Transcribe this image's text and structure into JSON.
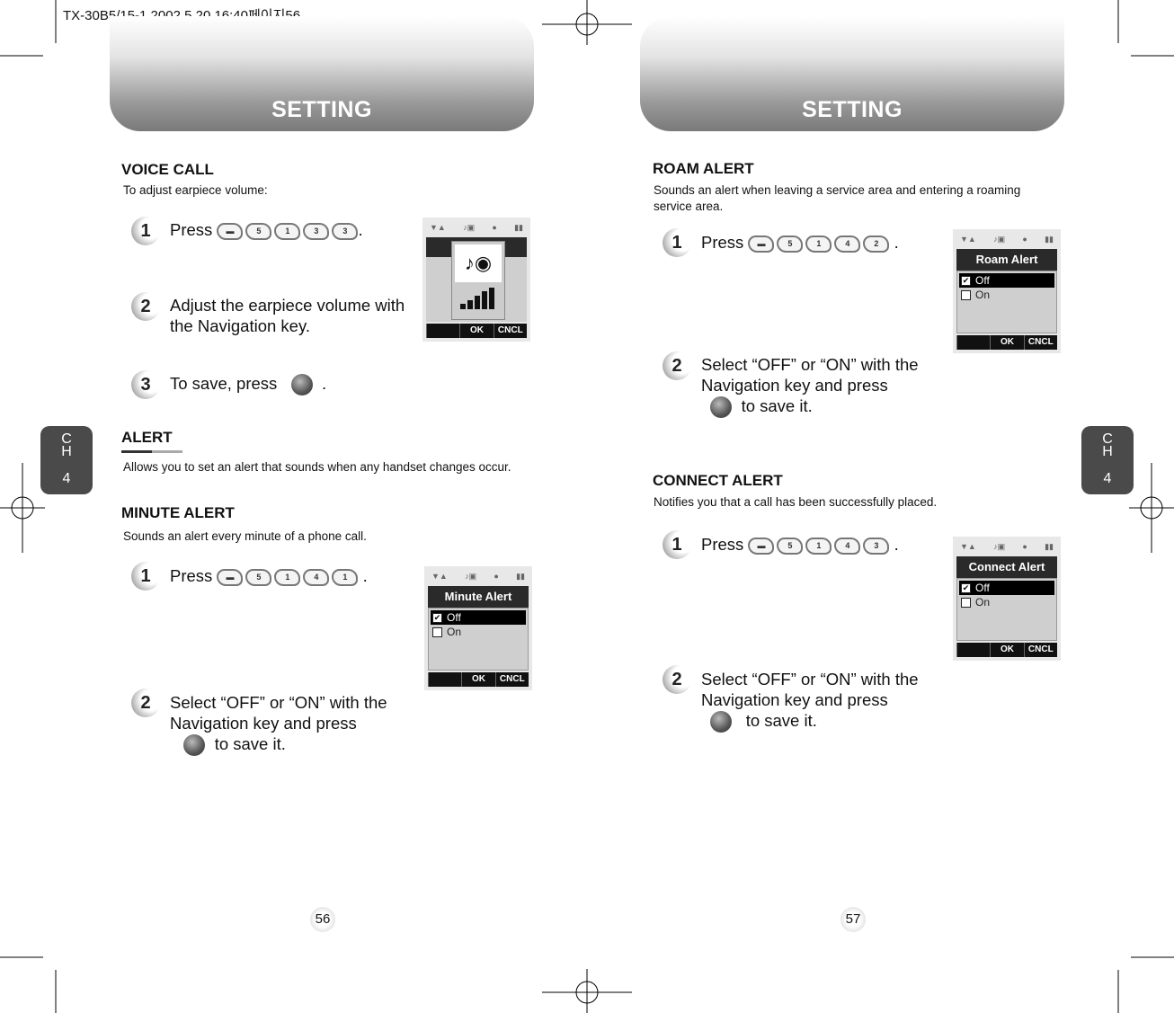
{
  "print_header": "TX-30B5/15-1  2002.5.20 16:40페이지56",
  "left": {
    "header": "SETTING",
    "chapter": {
      "c": "C",
      "h": "H",
      "n": "4"
    },
    "page": "56",
    "voice_call": {
      "title": "VOICE CALL",
      "desc": "To adjust earpiece volume:",
      "step1": {
        "n": "1",
        "text": "Press",
        "keys": [
          "menu",
          "5",
          "1",
          "3",
          "3"
        ],
        "end": "."
      },
      "step2": {
        "n": "2",
        "text": "Adjust the earpiece volume with the Navigation key."
      },
      "step3": {
        "n": "3",
        "text": "To save, press",
        "end": "."
      },
      "screen": {
        "softkeys": [
          "",
          "OK",
          "CNCL"
        ]
      }
    },
    "alert": {
      "title": "ALERT",
      "desc": "Allows you to set an alert that sounds when any handset changes occur."
    },
    "minute_alert": {
      "title": "MINUTE ALERT",
      "desc": "Sounds an alert every minute of a phone call.",
      "step1": {
        "n": "1",
        "text": "Press",
        "keys": [
          "menu",
          "5",
          "1",
          "4",
          "1"
        ],
        "end": "."
      },
      "step2": {
        "n": "2",
        "text": "Select “OFF” or “ON” with the Navigation key and press",
        "end": "to save it."
      },
      "screen": {
        "title": "Minute Alert",
        "options": [
          "Off",
          "On"
        ],
        "softkeys": [
          "",
          "OK",
          "CNCL"
        ]
      }
    }
  },
  "right": {
    "header": "SETTING",
    "chapter": {
      "c": "C",
      "h": "H",
      "n": "4"
    },
    "page": "57",
    "roam_alert": {
      "title": "ROAM ALERT",
      "desc": "Sounds an alert when leaving a service area and entering a roaming service area.",
      "step1": {
        "n": "1",
        "text": "Press",
        "keys": [
          "menu",
          "5",
          "1",
          "4",
          "2"
        ],
        "end": "."
      },
      "step2": {
        "n": "2",
        "text": "Select “OFF” or “ON” with the Navigation key and press",
        "end": "to save it."
      },
      "screen": {
        "title": "Roam Alert",
        "options": [
          "Off",
          "On"
        ],
        "softkeys": [
          "",
          "OK",
          "CNCL"
        ]
      }
    },
    "connect_alert": {
      "title": "CONNECT ALERT",
      "desc": "Notifies you that a call has been successfully placed.",
      "step1": {
        "n": "1",
        "text": "Press",
        "keys": [
          "menu",
          "5",
          "1",
          "4",
          "3"
        ],
        "end": "."
      },
      "step2": {
        "n": "2",
        "text": "Select “OFF” or “ON” with the Navigation key and press",
        "end": "to save it."
      },
      "screen": {
        "title": "Connect Alert",
        "options": [
          "Off",
          "On"
        ],
        "softkeys": [
          "",
          "OK",
          "CNCL"
        ]
      }
    }
  }
}
